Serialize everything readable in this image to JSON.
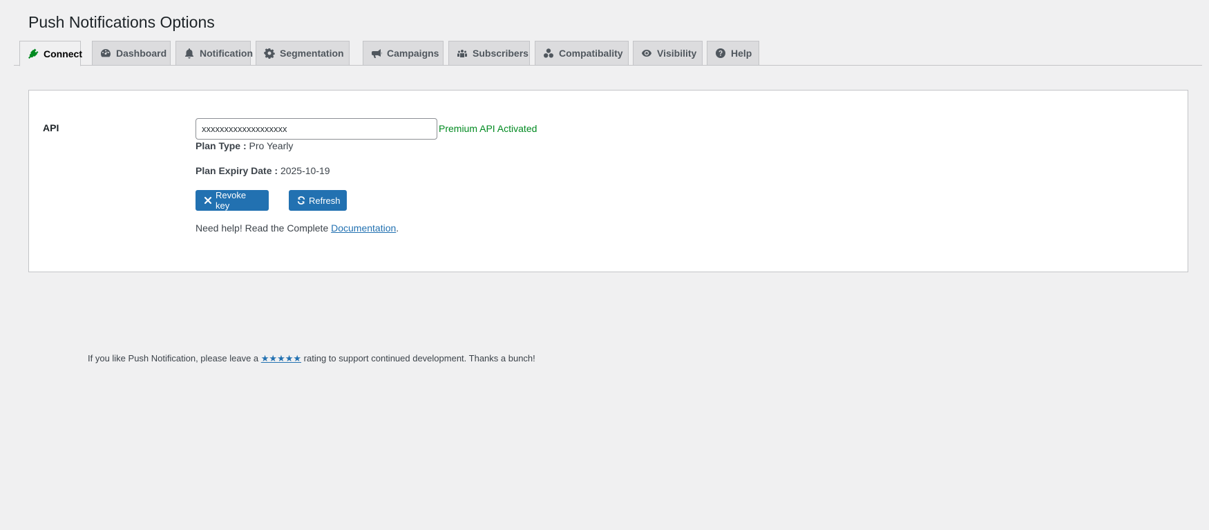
{
  "page": {
    "title": "Push Notifications Options"
  },
  "tabs": [
    {
      "label": "Connect",
      "icon": "plug-icon",
      "active": true
    },
    {
      "label": "Dashboard",
      "icon": "dashboard-icon",
      "active": false
    },
    {
      "label": "Notification",
      "icon": "bell-icon",
      "active": false
    },
    {
      "label": "Segmentation",
      "icon": "gear-icon",
      "active": false
    },
    {
      "label": "Campaigns",
      "icon": "megaphone-icon",
      "active": false
    },
    {
      "label": "Subscribers",
      "icon": "users-icon",
      "active": false
    },
    {
      "label": "Compatibality",
      "icon": "circles-icon",
      "active": false
    },
    {
      "label": "Visibility",
      "icon": "eye-icon",
      "active": false
    },
    {
      "label": "Help",
      "icon": "question-icon",
      "active": false
    }
  ],
  "connect": {
    "api_label": "API",
    "api_value": "xxxxxxxxxxxxxxxxxxx",
    "api_status": "Premium API Activated",
    "plan_type_label": "Plan Type :",
    "plan_type_value": "Pro Yearly",
    "plan_expiry_label": "Plan Expiry Date :",
    "plan_expiry_value": "2025-10-19",
    "revoke_label": "Revoke key",
    "refresh_label": "Refresh",
    "help_prefix": "Need help! Read the Complete",
    "help_link": "Documentation",
    "help_suffix": "."
  },
  "footer": {
    "prefix": "If you like Push Notification, please leave a",
    "stars": "★★★★★",
    "suffix": "rating to support continued development. Thanks a bunch!"
  },
  "colors": {
    "accent": "#2271b1",
    "success": "#008a20",
    "active_tab_icon": "#008a20",
    "background": "#f0f0f1"
  }
}
